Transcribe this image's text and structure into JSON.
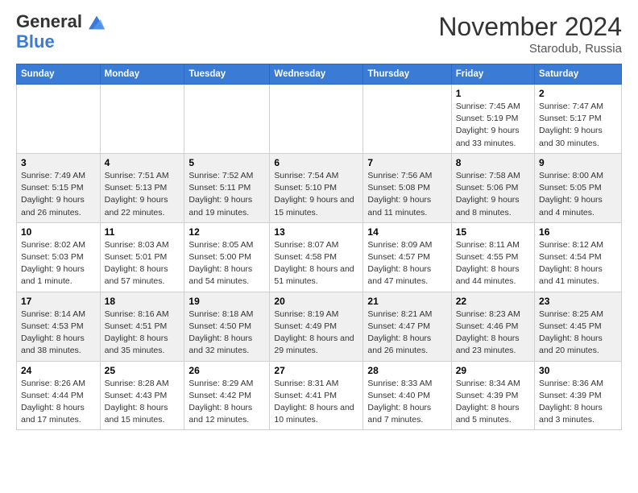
{
  "header": {
    "logo_line1": "General",
    "logo_line2": "Blue",
    "month": "November 2024",
    "location": "Starodub, Russia"
  },
  "weekdays": [
    "Sunday",
    "Monday",
    "Tuesday",
    "Wednesday",
    "Thursday",
    "Friday",
    "Saturday"
  ],
  "weeks": [
    [
      {
        "day": "",
        "info": ""
      },
      {
        "day": "",
        "info": ""
      },
      {
        "day": "",
        "info": ""
      },
      {
        "day": "",
        "info": ""
      },
      {
        "day": "",
        "info": ""
      },
      {
        "day": "1",
        "info": "Sunrise: 7:45 AM\nSunset: 5:19 PM\nDaylight: 9 hours and 33 minutes."
      },
      {
        "day": "2",
        "info": "Sunrise: 7:47 AM\nSunset: 5:17 PM\nDaylight: 9 hours and 30 minutes."
      }
    ],
    [
      {
        "day": "3",
        "info": "Sunrise: 7:49 AM\nSunset: 5:15 PM\nDaylight: 9 hours and 26 minutes."
      },
      {
        "day": "4",
        "info": "Sunrise: 7:51 AM\nSunset: 5:13 PM\nDaylight: 9 hours and 22 minutes."
      },
      {
        "day": "5",
        "info": "Sunrise: 7:52 AM\nSunset: 5:11 PM\nDaylight: 9 hours and 19 minutes."
      },
      {
        "day": "6",
        "info": "Sunrise: 7:54 AM\nSunset: 5:10 PM\nDaylight: 9 hours and 15 minutes."
      },
      {
        "day": "7",
        "info": "Sunrise: 7:56 AM\nSunset: 5:08 PM\nDaylight: 9 hours and 11 minutes."
      },
      {
        "day": "8",
        "info": "Sunrise: 7:58 AM\nSunset: 5:06 PM\nDaylight: 9 hours and 8 minutes."
      },
      {
        "day": "9",
        "info": "Sunrise: 8:00 AM\nSunset: 5:05 PM\nDaylight: 9 hours and 4 minutes."
      }
    ],
    [
      {
        "day": "10",
        "info": "Sunrise: 8:02 AM\nSunset: 5:03 PM\nDaylight: 9 hours and 1 minute."
      },
      {
        "day": "11",
        "info": "Sunrise: 8:03 AM\nSunset: 5:01 PM\nDaylight: 8 hours and 57 minutes."
      },
      {
        "day": "12",
        "info": "Sunrise: 8:05 AM\nSunset: 5:00 PM\nDaylight: 8 hours and 54 minutes."
      },
      {
        "day": "13",
        "info": "Sunrise: 8:07 AM\nSunset: 4:58 PM\nDaylight: 8 hours and 51 minutes."
      },
      {
        "day": "14",
        "info": "Sunrise: 8:09 AM\nSunset: 4:57 PM\nDaylight: 8 hours and 47 minutes."
      },
      {
        "day": "15",
        "info": "Sunrise: 8:11 AM\nSunset: 4:55 PM\nDaylight: 8 hours and 44 minutes."
      },
      {
        "day": "16",
        "info": "Sunrise: 8:12 AM\nSunset: 4:54 PM\nDaylight: 8 hours and 41 minutes."
      }
    ],
    [
      {
        "day": "17",
        "info": "Sunrise: 8:14 AM\nSunset: 4:53 PM\nDaylight: 8 hours and 38 minutes."
      },
      {
        "day": "18",
        "info": "Sunrise: 8:16 AM\nSunset: 4:51 PM\nDaylight: 8 hours and 35 minutes."
      },
      {
        "day": "19",
        "info": "Sunrise: 8:18 AM\nSunset: 4:50 PM\nDaylight: 8 hours and 32 minutes."
      },
      {
        "day": "20",
        "info": "Sunrise: 8:19 AM\nSunset: 4:49 PM\nDaylight: 8 hours and 29 minutes."
      },
      {
        "day": "21",
        "info": "Sunrise: 8:21 AM\nSunset: 4:47 PM\nDaylight: 8 hours and 26 minutes."
      },
      {
        "day": "22",
        "info": "Sunrise: 8:23 AM\nSunset: 4:46 PM\nDaylight: 8 hours and 23 minutes."
      },
      {
        "day": "23",
        "info": "Sunrise: 8:25 AM\nSunset: 4:45 PM\nDaylight: 8 hours and 20 minutes."
      }
    ],
    [
      {
        "day": "24",
        "info": "Sunrise: 8:26 AM\nSunset: 4:44 PM\nDaylight: 8 hours and 17 minutes."
      },
      {
        "day": "25",
        "info": "Sunrise: 8:28 AM\nSunset: 4:43 PM\nDaylight: 8 hours and 15 minutes."
      },
      {
        "day": "26",
        "info": "Sunrise: 8:29 AM\nSunset: 4:42 PM\nDaylight: 8 hours and 12 minutes."
      },
      {
        "day": "27",
        "info": "Sunrise: 8:31 AM\nSunset: 4:41 PM\nDaylight: 8 hours and 10 minutes."
      },
      {
        "day": "28",
        "info": "Sunrise: 8:33 AM\nSunset: 4:40 PM\nDaylight: 8 hours and 7 minutes."
      },
      {
        "day": "29",
        "info": "Sunrise: 8:34 AM\nSunset: 4:39 PM\nDaylight: 8 hours and 5 minutes."
      },
      {
        "day": "30",
        "info": "Sunrise: 8:36 AM\nSunset: 4:39 PM\nDaylight: 8 hours and 3 minutes."
      }
    ]
  ]
}
